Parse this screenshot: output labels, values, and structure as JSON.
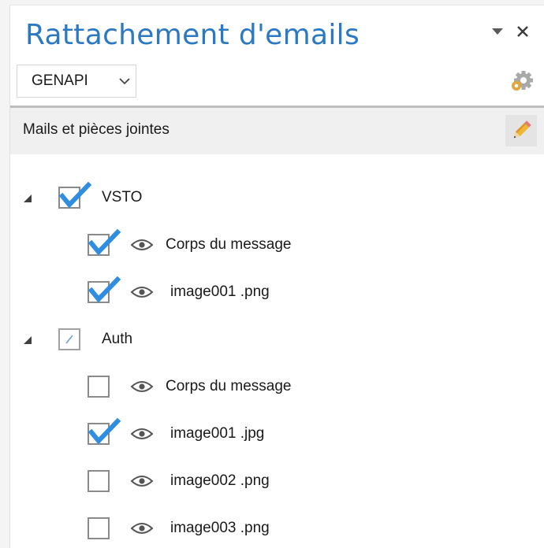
{
  "header": {
    "title": "Rattachement d'emails"
  },
  "toolbar": {
    "account_selected": "GENAPI"
  },
  "section": {
    "label": "Mails et pièces jointes"
  },
  "tree": {
    "groups": [
      {
        "label": "VSTO",
        "state": "checked",
        "items": [
          {
            "label": "Corps du message",
            "checked": true
          },
          {
            "label": "image001 .png",
            "checked": true
          }
        ]
      },
      {
        "label": "Auth",
        "state": "partial",
        "items": [
          {
            "label": "Corps du message",
            "checked": false
          },
          {
            "label": "image001 .jpg",
            "checked": true
          },
          {
            "label": "image002 .png",
            "checked": false
          },
          {
            "label": "image003 .png",
            "checked": false
          }
        ]
      }
    ]
  },
  "colors": {
    "title": "#2b79c2",
    "check": "#2f8ee0",
    "section_bg": "#f0f0f0"
  },
  "icons": [
    "dropdown-arrow-icon",
    "close-icon",
    "chevron-down-icon",
    "gear-icon",
    "pencil-icon",
    "expander-icon",
    "checkmark-icon",
    "eye-icon"
  ]
}
